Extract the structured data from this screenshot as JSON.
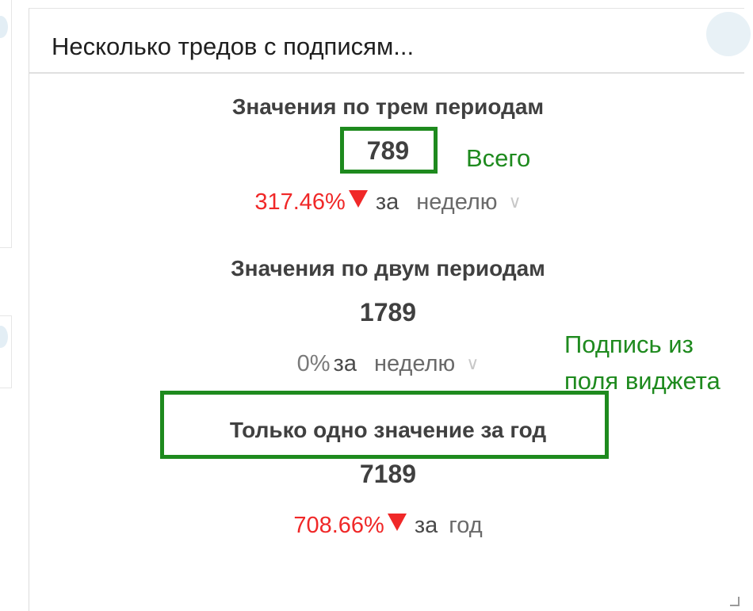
{
  "widget": {
    "title": "Несколько тредов с подписям..."
  },
  "metrics": [
    {
      "subtitle": "Значения по трем периодам",
      "value": "789",
      "change": "317.46%",
      "trend": "down",
      "word": "за",
      "period": "неделю"
    },
    {
      "subtitle": "Значения по двум периодам",
      "value": "1789",
      "change": "0%",
      "trend": "none",
      "word": "за",
      "period": "неделю"
    },
    {
      "subtitle": "Только одно значение за год",
      "value": "7189",
      "change": "708.66%",
      "trend": "down",
      "word": "за",
      "period": "год"
    }
  ],
  "annotations": {
    "total_label": "Всего",
    "caption_label_line1": "Подпись из",
    "caption_label_line2": "поля виджета"
  },
  "colors": {
    "negative": "#f02828",
    "annotation": "#1e8a1e"
  }
}
